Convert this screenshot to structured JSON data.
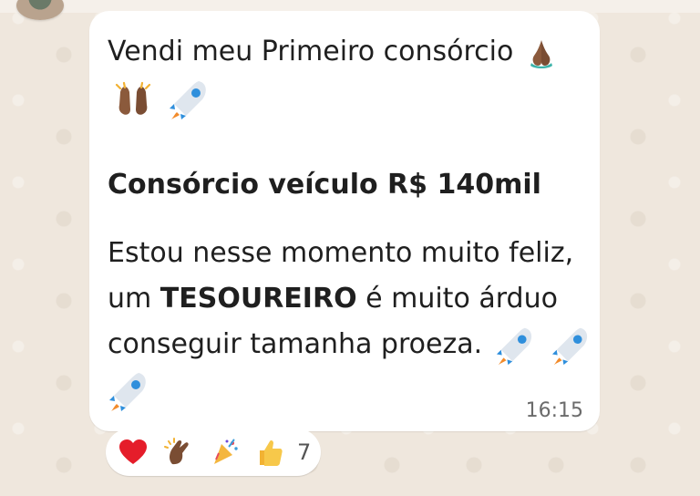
{
  "message": {
    "line1": "Vendi meu Primeiro consórcio",
    "line2_emojis": [
      "raised-hands-emoji",
      "rocket-emoji"
    ],
    "line3": "Consórcio veículo R$ 140mil",
    "line4": "Estou nesse momento muito feliz,",
    "line5_prefix": "um ",
    "line5_bold": "TESOUREIRO",
    "line5_suffix": " é muito árduo",
    "line6": "conseguir tamanha proeza.",
    "time": "16:15"
  },
  "reactions": {
    "items": [
      "heart-emoji",
      "clapping-hands-emoji",
      "party-popper-emoji",
      "thumbs-up-emoji"
    ],
    "count": "7"
  }
}
